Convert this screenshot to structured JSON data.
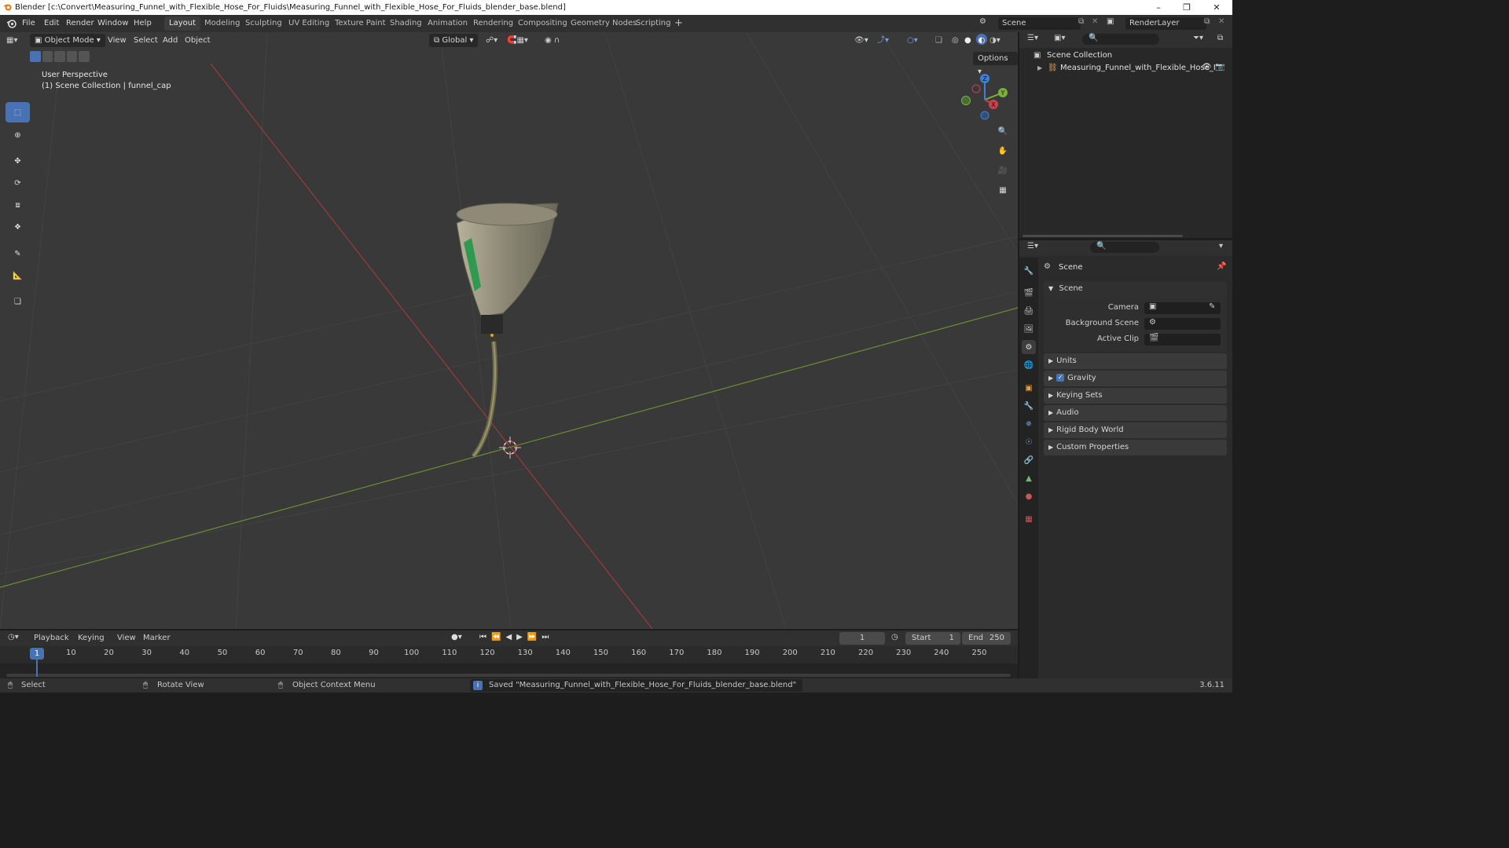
{
  "window": {
    "title": "Blender [c:\\Convert\\Measuring_Funnel_with_Flexible_Hose_For_Fluids\\Measuring_Funnel_with_Flexible_Hose_For_Fluids_blender_base.blend]",
    "minimize_icon": "minimize-icon",
    "maximize_icon": "maximize-icon",
    "close_icon": "close-icon"
  },
  "menubar": {
    "items": [
      "File",
      "Edit",
      "Render",
      "Window",
      "Help"
    ],
    "workspaces": [
      "Layout",
      "Modeling",
      "Sculpting",
      "UV Editing",
      "Texture Paint",
      "Shading",
      "Animation",
      "Rendering",
      "Compositing",
      "Geometry Nodes",
      "Scripting"
    ],
    "active_workspace": "Layout",
    "add_workspace": "+",
    "scene_label": "Scene",
    "render_layer_label": "RenderLayer"
  },
  "viewport_header": {
    "mode": "Object Mode",
    "menus": [
      "View",
      "Select",
      "Add",
      "Object"
    ],
    "transform_orientation": "Global",
    "options_label": "Options"
  },
  "viewport": {
    "perspective_label": "User Perspective",
    "context_label": "(1) Scene Collection | funnel_cap",
    "gizmo_axes": [
      "X",
      "Y",
      "Z"
    ]
  },
  "outliner": {
    "root": "Scene Collection",
    "items": [
      {
        "label": "Measuring_Funnel_with_Flexible_Hose_I"
      }
    ]
  },
  "properties": {
    "header": "Scene",
    "section": "Scene",
    "fields": [
      {
        "label": "Camera"
      },
      {
        "label": "Background Scene"
      },
      {
        "label": "Active Clip"
      }
    ],
    "subpanels": [
      "Units",
      "Gravity",
      "Keying Sets",
      "Audio",
      "Rigid Body World",
      "Custom Properties"
    ],
    "gravity_checked": true
  },
  "timeline": {
    "menus": [
      "Playback",
      "Keying",
      "View",
      "Marker"
    ],
    "current_frame": "1",
    "start_label": "Start",
    "start_value": "1",
    "end_label": "End",
    "end_value": "250",
    "ticks": [
      "1",
      "10",
      "20",
      "30",
      "40",
      "50",
      "60",
      "70",
      "80",
      "90",
      "100",
      "110",
      "120",
      "130",
      "140",
      "150",
      "160",
      "170",
      "180",
      "190",
      "200",
      "210",
      "220",
      "230",
      "240",
      "250"
    ]
  },
  "statusbar": {
    "select": "Select",
    "rotate": "Rotate View",
    "context_menu": "Object Context Menu",
    "message": "Saved \"Measuring_Funnel_with_Flexible_Hose_For_Fluids_blender_base.blend\"",
    "version": "3.6.11"
  },
  "colors": {
    "accent": "#4772b3",
    "x_axis": "#c9424f",
    "y_axis": "#7ab03b",
    "z_axis": "#3f7fd6",
    "viewport_bg": "#393939"
  }
}
